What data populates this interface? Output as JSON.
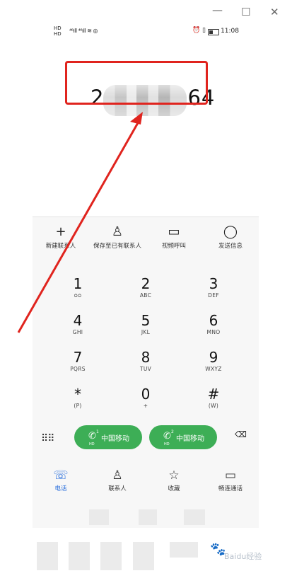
{
  "window": {
    "min_label": "—",
    "max_label": "☐",
    "close_label": "✕"
  },
  "status": {
    "left_hd": "HD\nHD",
    "signals": "⁴⁶ıll ⁴⁶ıll ≋ ◎",
    "icons": "⏰ ▯ ",
    "time": "11:08"
  },
  "display": {
    "number_start": "2",
    "number_end": "64"
  },
  "actions": [
    {
      "icon": "plus-icon",
      "glyph": "+",
      "label": "新建联系人"
    },
    {
      "icon": "person-icon",
      "glyph": "♙",
      "label": "保存至已有联系人"
    },
    {
      "icon": "video-icon",
      "glyph": "▭",
      "label": "视频呼叫"
    },
    {
      "icon": "message-icon",
      "glyph": "◯",
      "label": "发送信息"
    }
  ],
  "keypad": [
    {
      "digit": "1",
      "letters": "ᴑᴑ"
    },
    {
      "digit": "2",
      "letters": "ABC"
    },
    {
      "digit": "3",
      "letters": "DEF"
    },
    {
      "digit": "4",
      "letters": "GHI"
    },
    {
      "digit": "5",
      "letters": "JKL"
    },
    {
      "digit": "6",
      "letters": "MNO"
    },
    {
      "digit": "7",
      "letters": "PQRS"
    },
    {
      "digit": "8",
      "letters": "TUV"
    },
    {
      "digit": "9",
      "letters": "WXYZ"
    },
    {
      "digit": "*",
      "letters": "(P)"
    },
    {
      "digit": "0",
      "letters": "+"
    },
    {
      "digit": "#",
      "letters": "(W)"
    }
  ],
  "call": {
    "sim1": {
      "label": "中国移动",
      "sim": "1",
      "hd": "HD"
    },
    "sim2": {
      "label": "中国移动",
      "sim": "2",
      "hd": "HD"
    }
  },
  "nav": [
    {
      "icon": "phone-icon",
      "glyph": "☏",
      "label": "电话",
      "active": true
    },
    {
      "icon": "contacts-icon",
      "glyph": "♙",
      "label": "联系人",
      "active": false
    },
    {
      "icon": "star-icon",
      "glyph": "☆",
      "label": "收藏",
      "active": false
    },
    {
      "icon": "video-call-icon",
      "glyph": "▭",
      "label": "畅连通话",
      "active": false
    }
  ],
  "watermark": {
    "text": "Baidu经验"
  },
  "colors": {
    "call_green": "#3dae56",
    "accent_blue": "#2a6fdc",
    "annotation_red": "#e0241e"
  }
}
